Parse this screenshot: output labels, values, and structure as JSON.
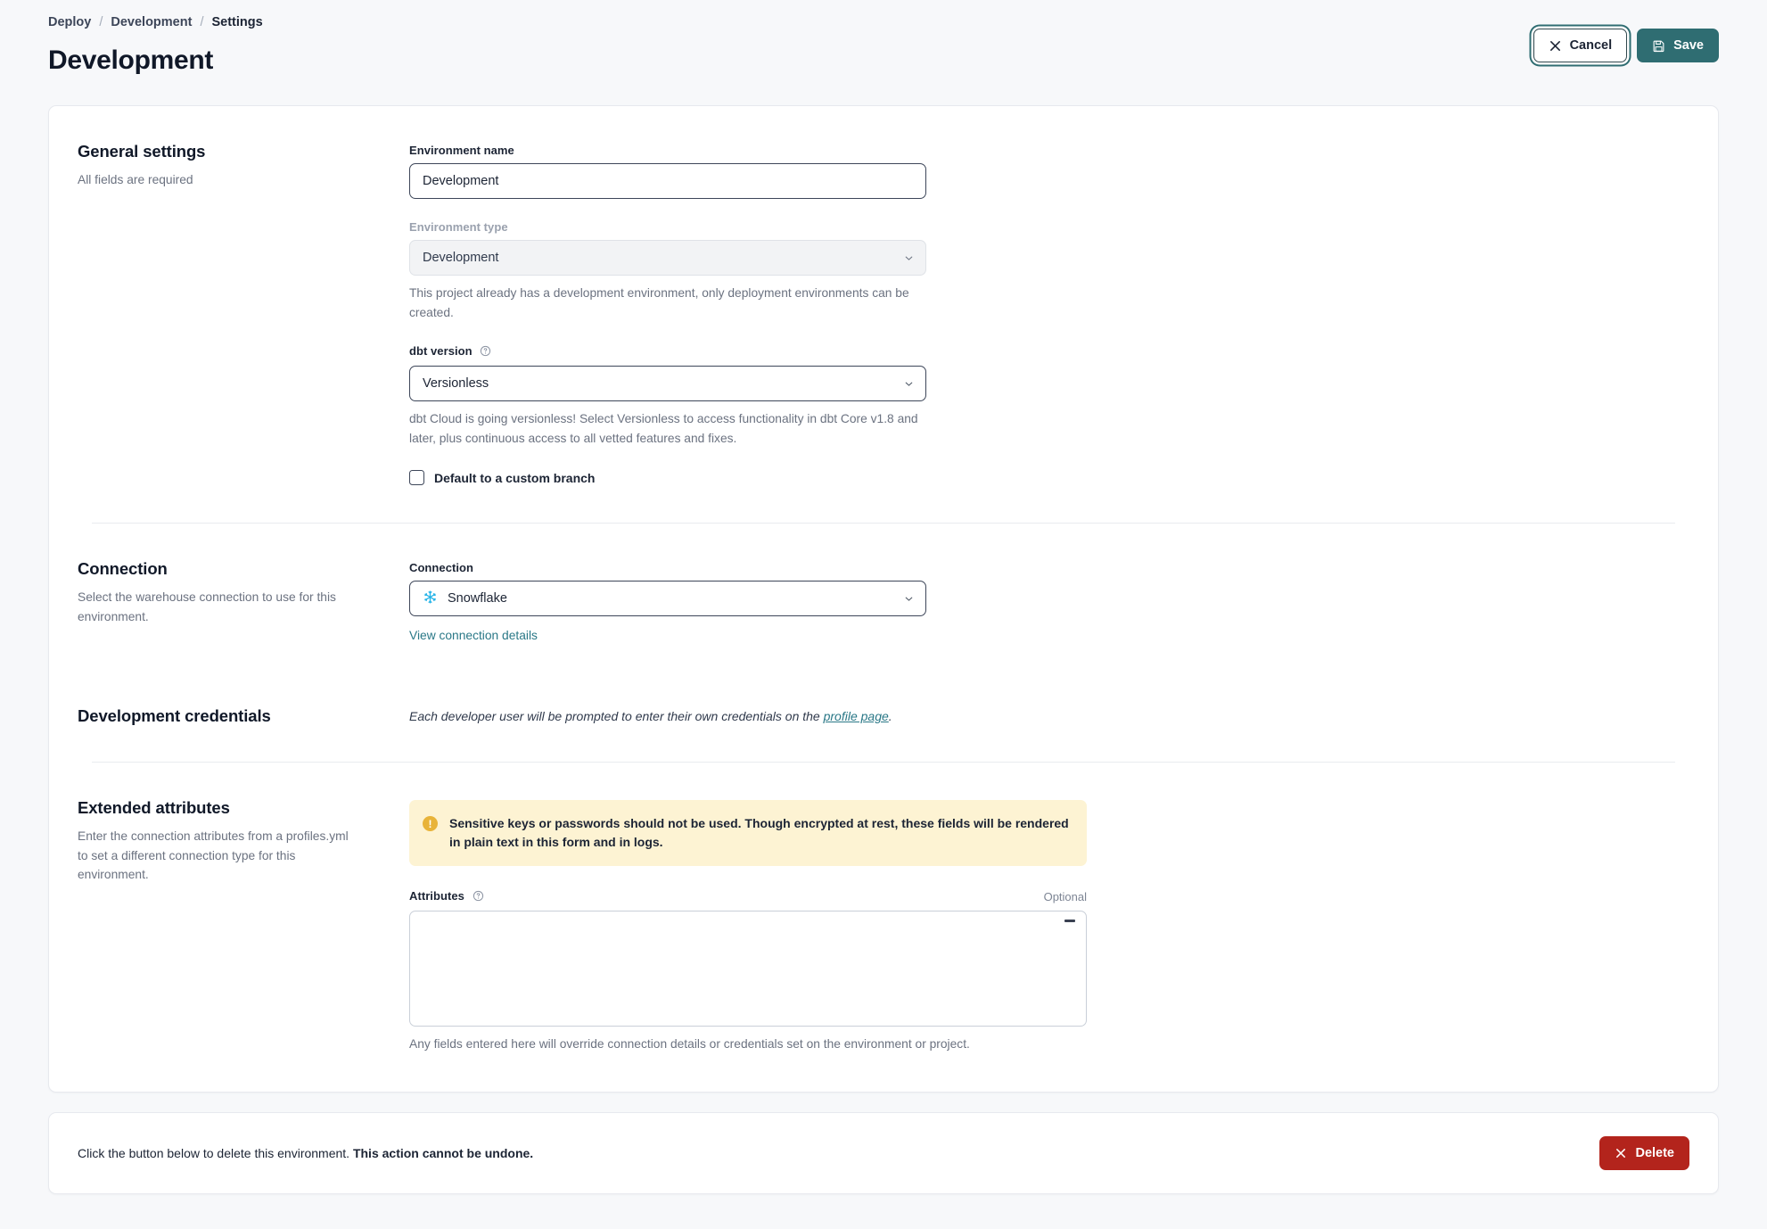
{
  "breadcrumb": {
    "items": [
      "Deploy",
      "Development",
      "Settings"
    ],
    "separator": "/",
    "deploy": "Deploy",
    "environment": "Development",
    "current": "Settings"
  },
  "header": {
    "title": "Development",
    "cancel_label": "Cancel",
    "save_label": "Save"
  },
  "general": {
    "title": "General settings",
    "subtitle": "All fields are required",
    "environment_name": {
      "label": "Environment name",
      "value": "Development",
      "placeholder": "Environment name"
    },
    "environment_type": {
      "label": "Environment type",
      "value": "Development",
      "hint": "This project already has a development environment, only deployment environments can be created."
    },
    "dbt_version": {
      "label": "dbt version",
      "value": "Versionless",
      "hint": "dbt Cloud is going versionless! Select Versionless to access functionality in dbt Core v1.8 and later, plus continuous access to all vetted features and fixes."
    },
    "custom_branch": {
      "label": "Default to a custom branch",
      "checked": false
    }
  },
  "connection": {
    "title": "Connection",
    "subtitle": "Select the warehouse connection to use for this environment.",
    "field_label": "Connection",
    "value": "Snowflake",
    "icon": "snowflake-icon",
    "icon_color": "#29b5e8",
    "details_link": "View connection details"
  },
  "credentials": {
    "title": "Development credentials",
    "note_before": "Each developer user will be prompted to enter their own credentials on the ",
    "note_link": "profile page",
    "note_after": "."
  },
  "extended": {
    "title": "Extended attributes",
    "subtitle": "Enter the connection attributes from a profiles.yml to set a different connection type for this environment.",
    "warning": "Sensitive keys or passwords should not be used. Though encrypted at rest, these fields will be rendered in plain text in this form and in logs.",
    "attributes_label": "Attributes",
    "optional_tag": "Optional",
    "attributes_value": "",
    "attributes_hint": "Any fields entered here will override connection details or credentials set on the environment or project."
  },
  "delete": {
    "text_before": "Click the button below to delete this environment. ",
    "text_bold": "This action cannot be undone.",
    "button_label": "Delete"
  },
  "colors": {
    "accent_teal": "#2f6d72",
    "danger_red": "#b3241c",
    "link_teal": "#2a7887",
    "warning_yellow": "#fdf3d3",
    "warning_icon": "#e8b339",
    "snowflake_blue": "#29b5e8",
    "page_bg": "#f7f8fa"
  }
}
